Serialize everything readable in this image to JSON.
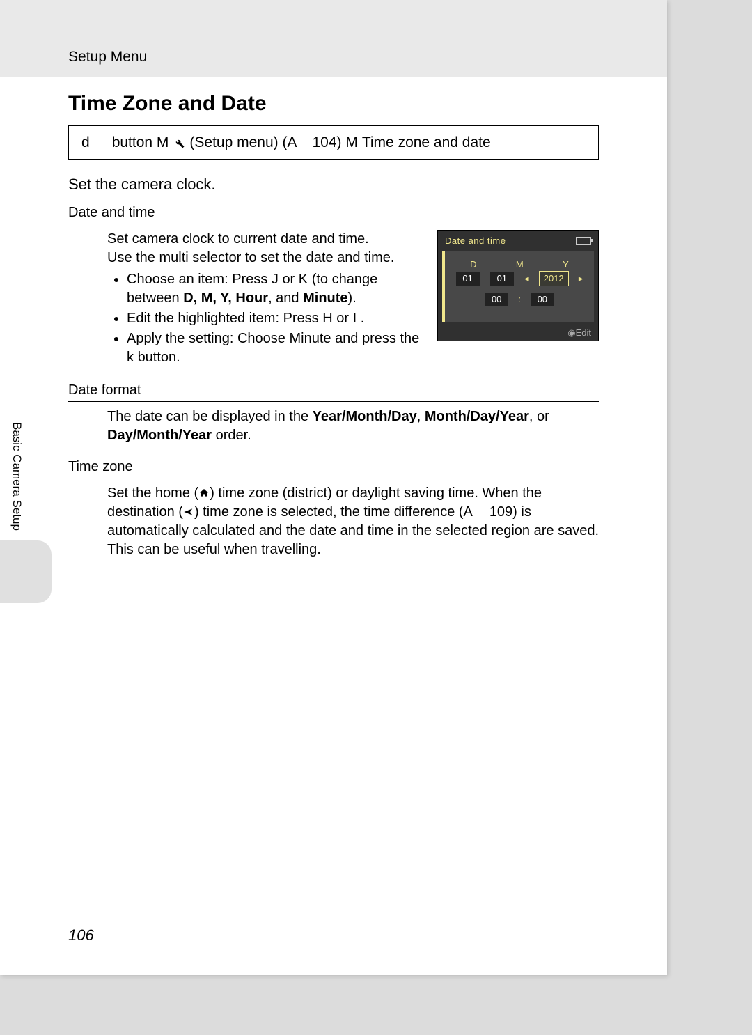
{
  "header": {
    "breadcrumb": "Setup Menu"
  },
  "title": "Time Zone and Date",
  "navbox": {
    "d": "d",
    "buttonM1": "button M",
    "setup": "(Setup menu) (A",
    "pageref": "104) M",
    "tail": "Time zone and date"
  },
  "lead": "Set the camera clock.",
  "sections": {
    "date_and_time": {
      "header": "Date and time",
      "intro1": "Set camera clock to current date and time.",
      "intro2": "Use the multi selector to set the date and time.",
      "b1_pre": "Choose an item: Press J",
      "b1_mid": "or K",
      "b1_post": "(to change between",
      "b1_bold": "D, M, Y, Hour",
      "b1_and": ", and ",
      "b1_bold2": "Minute",
      "b1_end": ").",
      "b2_pre": "Edit the highlighted item: Press H",
      "b2_mid": "or I",
      "b2_end": ".",
      "b3_pre": "Apply the setting: Choose Minute and press the k",
      "b3_end": "button."
    },
    "date_format": {
      "header": "Date format",
      "text_pre": "The date can be displayed in the ",
      "opt1": "Year/Month/Day",
      "sep1": ", ",
      "opt2": "Month/Day/Year",
      "sep2": ", or ",
      "opt3": "Day/Month/Year",
      "text_post": " order."
    },
    "time_zone": {
      "header": "Time zone",
      "t1": "Set the home (",
      "t2": ") time zone (district) or daylight saving time. When the destination (",
      "t3": ") time zone is selected, the time difference (A",
      "t4": "109) is automatically calculated and the date and time in the selected region are saved. This can be useful when travelling."
    }
  },
  "camera_screen": {
    "title": "Date and time",
    "D": "D",
    "M": "M",
    "Y": "Y",
    "d_val": "01",
    "m_val": "01",
    "y_val": "2012",
    "hh": "00",
    "colon": ":",
    "mm": "00",
    "edit": "Edit"
  },
  "side_tab": "Basic Camera Setup",
  "page_number": "106"
}
